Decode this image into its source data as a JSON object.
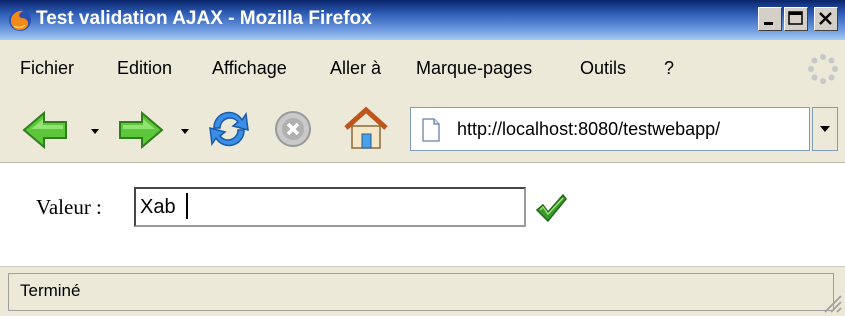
{
  "window": {
    "title": "Test validation AJAX - Mozilla Firefox",
    "controls": [
      "minimize",
      "maximize",
      "close"
    ]
  },
  "menu": {
    "items": [
      {
        "label": "Fichier"
      },
      {
        "label": "Edition"
      },
      {
        "label": "Affichage"
      },
      {
        "label": "Aller à"
      },
      {
        "label": "Marque-pages"
      },
      {
        "label": "Outils"
      },
      {
        "label": "?"
      }
    ]
  },
  "toolbar": {
    "back_icon": "back-arrow-icon",
    "forward_icon": "forward-arrow-icon",
    "reload_icon": "reload-icon",
    "stop_icon": "stop-icon",
    "home_icon": "home-icon"
  },
  "address": {
    "url": "http://localhost:8080/testwebapp/"
  },
  "form": {
    "label": "Valeur :",
    "value": "Xab",
    "valid_icon": "checkmark-icon",
    "valid_color": "#3a9a2a"
  },
  "status": {
    "text": "Terminé"
  }
}
